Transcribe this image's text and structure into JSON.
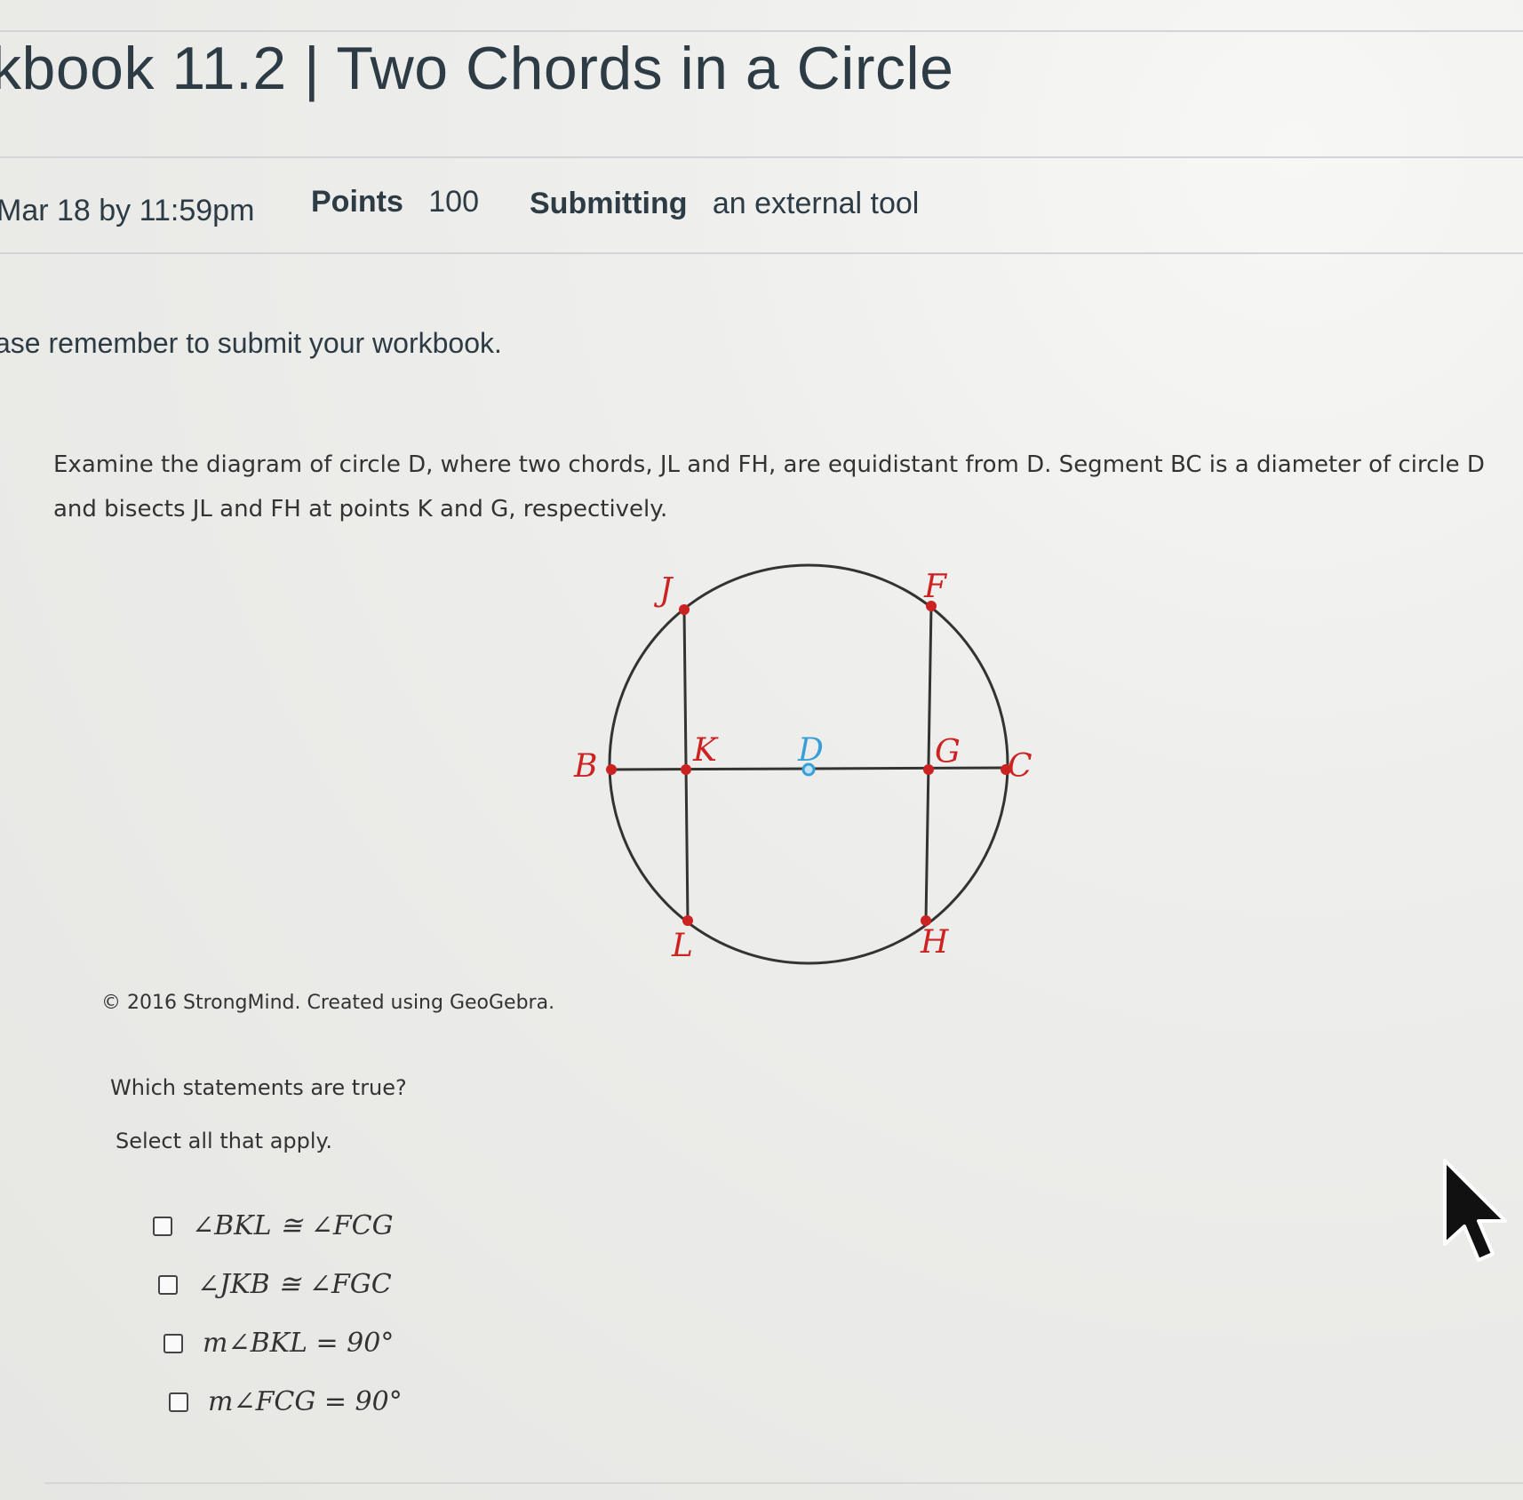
{
  "header": {
    "title": "kbook 11.2 | Two Chords in a Circle"
  },
  "meta": {
    "due": "Mar 18 by 11:59pm",
    "points_label": "Points",
    "points_value": "100",
    "submitting_label": "Submitting",
    "submitting_value": "an external tool"
  },
  "reminder": "ase remember to submit your workbook.",
  "problem": {
    "prompt_line1": "Examine the diagram of circle D, where two chords, JL and FH, are equidistant from D. Segment BC is a diameter of circle D",
    "prompt_line2": "and bisects JL and FH at points K and G, respectively.",
    "copyright": "© 2016 StrongMind. Created using GeoGebra.",
    "question": "Which statements are true?",
    "instruction": "Select all that apply."
  },
  "diagram": {
    "points": [
      "J",
      "F",
      "B",
      "K",
      "D",
      "G",
      "C",
      "L",
      "H"
    ],
    "colors": {
      "line": "#333333",
      "point": "#cc2222",
      "center": "#3a9fd6"
    }
  },
  "options": [
    {
      "label": "∠BKL ≅ ∠FCG",
      "checked": false
    },
    {
      "label": "∠JKB ≅ ∠FGC",
      "checked": false
    },
    {
      "label": "m∠BKL = 90°",
      "checked": false
    },
    {
      "label": "m∠FCG = 90°",
      "checked": false
    }
  ]
}
